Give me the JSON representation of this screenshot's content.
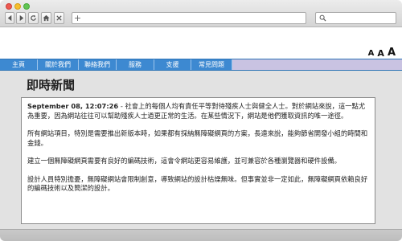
{
  "browser": {
    "buttons": [
      "back",
      "forward",
      "reload",
      "home",
      "close"
    ],
    "new_tab_label": "+",
    "url_value": "",
    "search_value": ""
  },
  "font_sizer": {
    "small": "A",
    "medium": "A",
    "large": "A"
  },
  "menu": {
    "items": [
      {
        "label": "主頁"
      },
      {
        "label": "關於我們"
      },
      {
        "label": "聯絡我們"
      },
      {
        "label": "服務"
      },
      {
        "label": "支援"
      },
      {
        "label": "常見問題"
      }
    ]
  },
  "page": {
    "title": "即時新聞",
    "timestamp": "September 08, 12:07:26",
    "paragraphs": [
      " - 社會上的每個人均有責任平等對待殘疾人士與健全人士。對於網站來說，這一點尤為重要，因為網站往往可以幫助殘疾人士過更正常的生活。在某些情況下，網站是他們獲取資訊的唯一途徑。",
      "所有網站項目，特別是需要推出新版本時，如果都有採納無障礙網頁的方案，長遠來說，能夠節省開發小組的時間和金錢。",
      "建立一個無障礙網頁需要有良好的編碼技術，這會令網站更容易維護，並可兼容於各種瀏覽器和硬件設備。",
      "設計人員特別擔憂，無障礙網站會限制創意，導致網站的設計枯燥無味。但事實並非一定如此，無障礙網頁依賴良好的編碼技術以及簡潔的設計。"
    ]
  },
  "colors": {
    "menu_bar": "#3d89d1",
    "menu_filler": "#c9c3e2",
    "content_bg": "#e2e2e2"
  }
}
